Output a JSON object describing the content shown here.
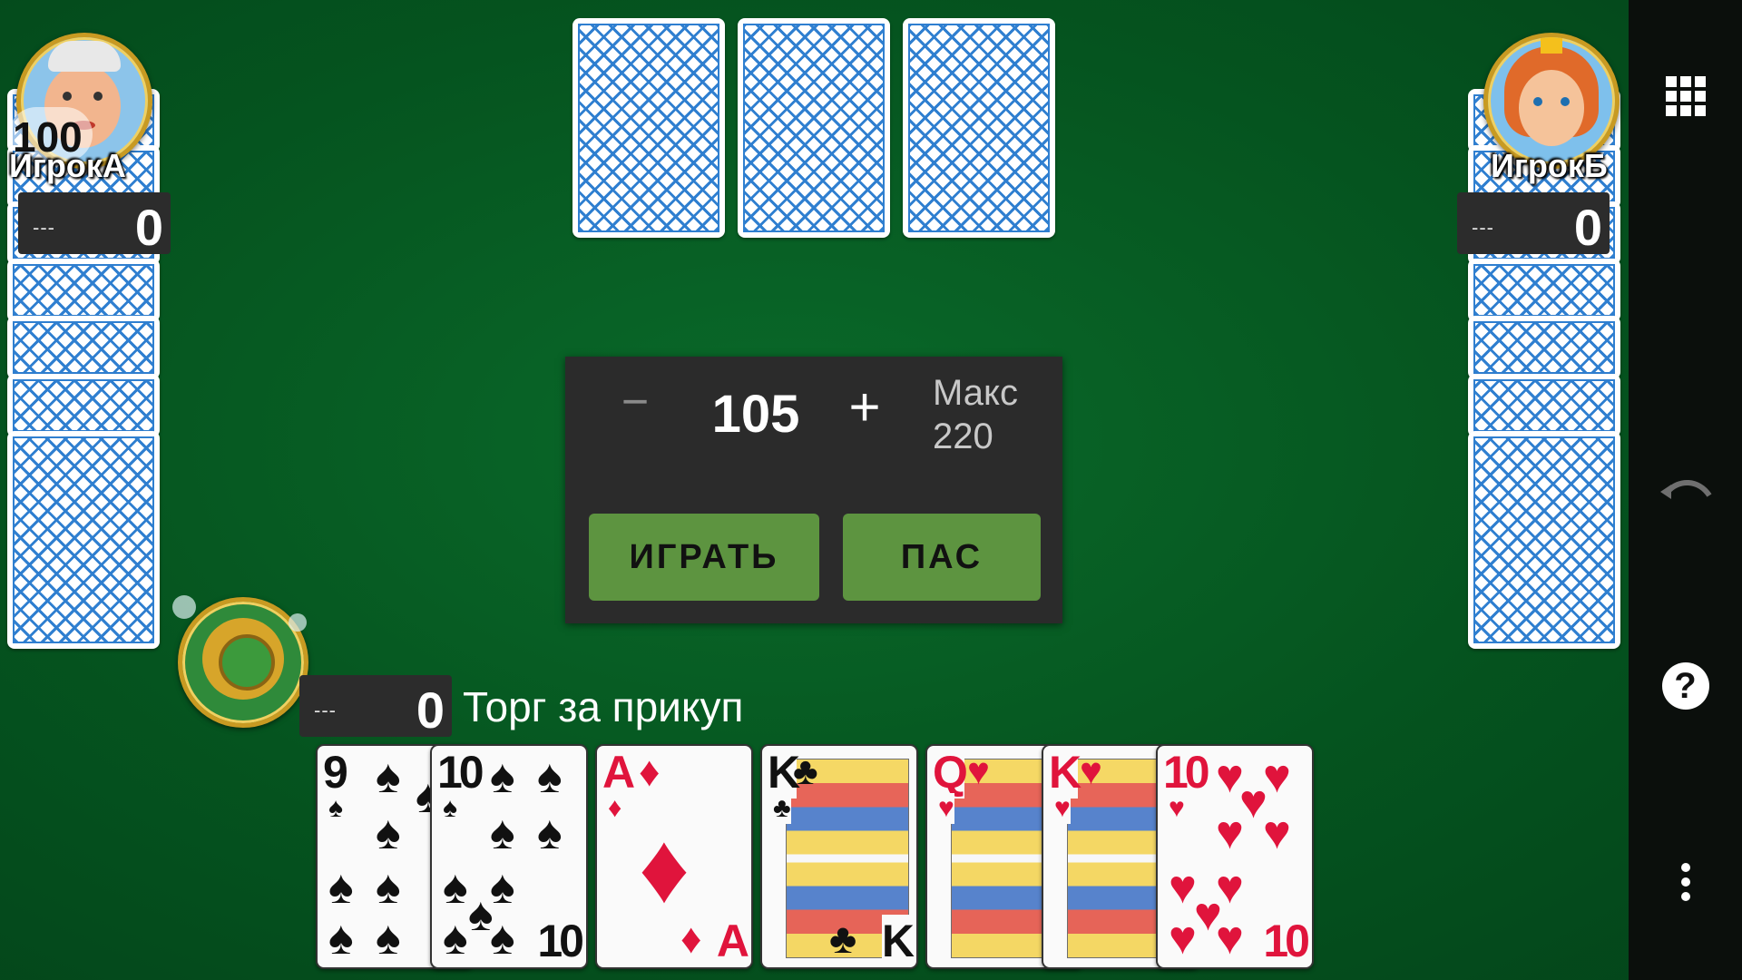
{
  "players": {
    "left": {
      "name": "ИгрокА",
      "badge": "100",
      "bid": "---",
      "score": "0"
    },
    "right": {
      "name": "ИгрокБ",
      "bid": "---",
      "score": "0"
    },
    "me": {
      "bid": "---",
      "score": "0"
    }
  },
  "bid_panel": {
    "minus": "−",
    "value": "105",
    "plus": "+",
    "max_label": "Макс",
    "max_value": "220",
    "play_button": "ИГРАТЬ",
    "pass_button": "ПАС"
  },
  "status_text": "Торг за прикуп",
  "hand": [
    {
      "rank": "9",
      "suit": "♠",
      "color": "black"
    },
    {
      "rank": "10",
      "suit": "♠",
      "color": "black"
    },
    {
      "rank": "A",
      "suit": "♦",
      "color": "red"
    },
    {
      "rank": "K",
      "suit": "♣",
      "color": "black"
    },
    {
      "rank": "Q",
      "suit": "♥",
      "color": "red"
    },
    {
      "rank": "K",
      "suit": "♥",
      "color": "red"
    },
    {
      "rank": "10",
      "suit": "♥",
      "color": "red"
    }
  ],
  "sidebar": {
    "menu_icon": "grid-menu-icon",
    "undo_icon": "undo-icon",
    "help_icon": "help-icon",
    "more_icon": "more-vertical-icon",
    "help_glyph": "?"
  },
  "colors": {
    "table_green": "#05541f",
    "button_green": "#5d9440",
    "card_back_blue": "#2f7fd0"
  }
}
